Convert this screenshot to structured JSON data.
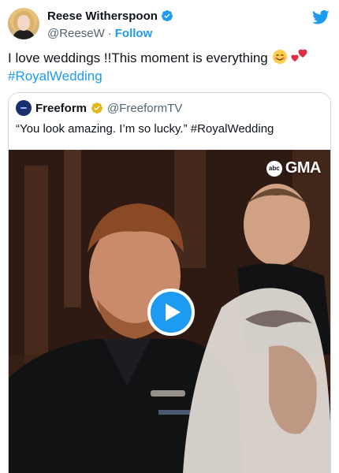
{
  "author": {
    "display_name": "Reese Witherspoon",
    "handle": "@ReeseW",
    "separator": "·",
    "follow_label": "Follow"
  },
  "tweet": {
    "text_line1": "I love weddings !!This moment is everything",
    "emojis": [
      "smiling-face-icon",
      "two-hearts-icon"
    ],
    "hashtag": "#RoyalWedding"
  },
  "quoted": {
    "display_name": "Freeform",
    "handle": "@FreeformTV",
    "text": "“You look amazing. I’m so lucky.” #RoyalWedding",
    "media": {
      "watermark_badge": "abc",
      "watermark_text": "GMA",
      "play_icon": "play-icon"
    }
  },
  "colors": {
    "accent": "#1d9bf0",
    "text": "#0f1419",
    "muted": "#536471",
    "border": "#cfd9de",
    "verified_gold": "#e2b719"
  }
}
